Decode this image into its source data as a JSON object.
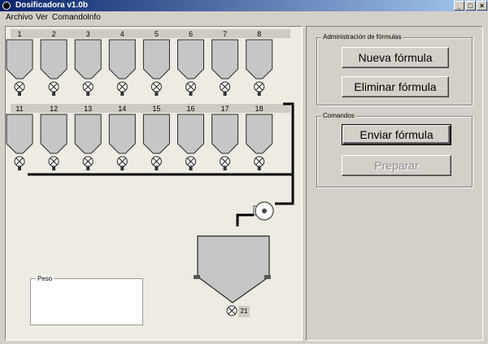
{
  "window": {
    "title": "Dosificadora v1.0b",
    "controls": [
      "_",
      "□",
      "×"
    ]
  },
  "menu": [
    "Archivo",
    "Ver",
    "Comando",
    "Info"
  ],
  "hoppers_row1": [
    "1",
    "2",
    "3",
    "4",
    "5",
    "6",
    "7",
    "8"
  ],
  "hoppers_row2": [
    "11",
    "12",
    "13",
    "14",
    "15",
    "16",
    "17",
    "18"
  ],
  "mixer": {
    "label": "21"
  },
  "peso": {
    "title": "Peso"
  },
  "admin": {
    "title": "Administración de fórmulas",
    "new_button": "Nueva fórmula",
    "delete_button": "Eliminar fórmula"
  },
  "commands": {
    "title": "Comandos",
    "send_button": "Enviar fórmula",
    "prepare_button": "Preparar"
  }
}
